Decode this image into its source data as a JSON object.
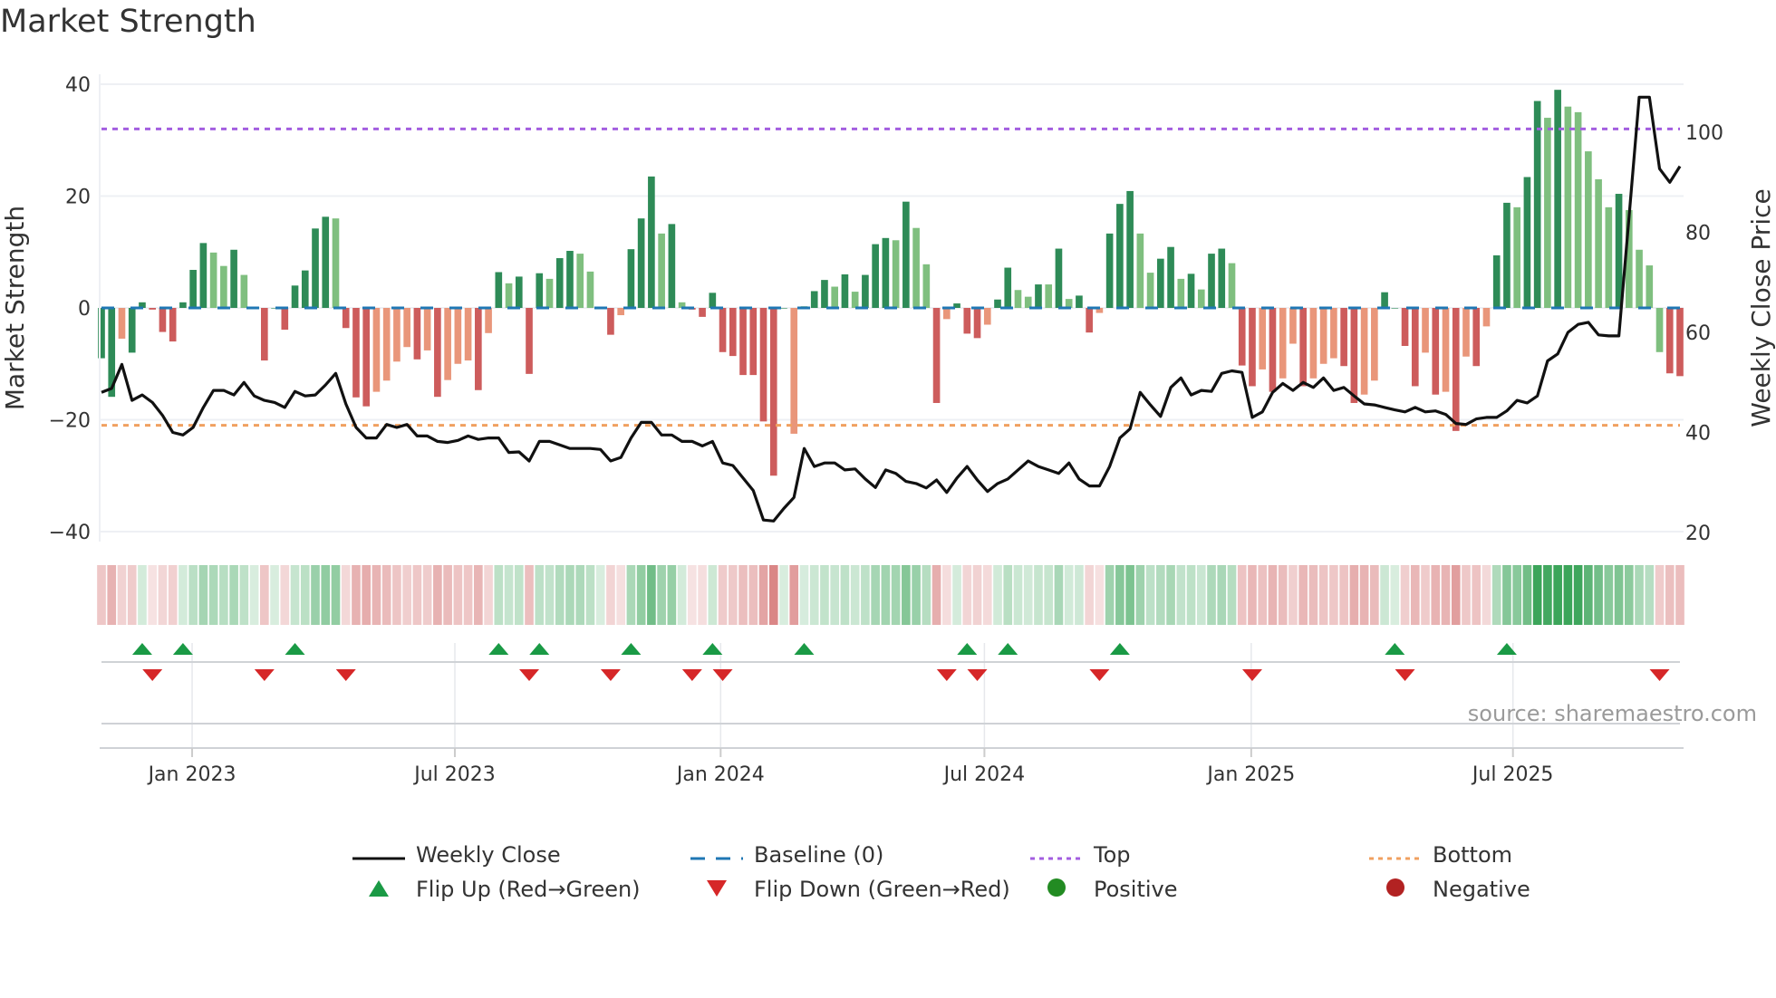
{
  "title": "Market Strength",
  "source": "source: sharemaestro.com",
  "colors": {
    "strong_up": "#2e8b57",
    "weak_up": "#7fbf7f",
    "strong_down": "#cd5c5c",
    "weak_down": "#e9967a",
    "line": "#111111",
    "baseline": "#1f77b4",
    "top": "#a35ee0",
    "bottom": "#f0a060",
    "flip_up": "#1a9a45",
    "flip_down": "#d62728",
    "positive": "#228b22",
    "negative": "#b22222"
  },
  "legend": {
    "weekly_close": "Weekly Close",
    "baseline": "Baseline (0)",
    "top": "Top",
    "bottom": "Bottom",
    "flip_up": "Flip Up (Red→Green)",
    "flip_down": "Flip Down (Green→Red)",
    "positive": "Positive",
    "negative": "Negative"
  },
  "chart_data": {
    "type": "bar",
    "title": "Market Strength",
    "ylabel": "Market Strength",
    "y2label": "Weekly Close Price",
    "ylim": [
      -42,
      42
    ],
    "y2lim": [
      20,
      110
    ],
    "yticks": [
      "40",
      "20",
      "0",
      "−20",
      "−40"
    ],
    "ytick_values": [
      40,
      20,
      0,
      -20,
      -40
    ],
    "y2ticks": [
      "100",
      "80",
      "60",
      "40",
      "20"
    ],
    "y2tick_values": [
      100,
      80,
      60,
      40,
      20
    ],
    "top_level": 32,
    "bottom_level": -21,
    "xticks": [
      {
        "label": "Jan 2023",
        "week": 8.9
      },
      {
        "label": "Jul 2023",
        "week": 34.7
      },
      {
        "label": "Jan 2024",
        "week": 60.8
      },
      {
        "label": "Jul 2024",
        "week": 86.7
      },
      {
        "label": "Jan 2025",
        "week": 112.9
      },
      {
        "label": "Jul 2025",
        "week": 138.6
      }
    ],
    "strength": [
      -9,
      -15.9,
      -5.5,
      -8,
      1,
      -0.3,
      -4.3,
      -6,
      1,
      6.8,
      11.6,
      9.9,
      7.5,
      10.4,
      5.9,
      0,
      -9.4,
      0,
      -3.9,
      4,
      6.7,
      14.2,
      16.3,
      16,
      -3.6,
      -16,
      -17.6,
      -15,
      -13,
      -9.6,
      -7,
      -9.2,
      -7.6,
      -15.9,
      -12.9,
      -10,
      -9.4,
      -14.7,
      -4.5,
      6.4,
      4.4,
      5.6,
      -11.8,
      6.2,
      5.2,
      8.9,
      10.2,
      9.7,
      6.5,
      0,
      -4.8,
      -1.3,
      10.5,
      16,
      23.5,
      13.3,
      15,
      1,
      -0.3,
      -1.6,
      2.7,
      -7.9,
      -8.6,
      -12,
      -12,
      -20.3,
      -30,
      0,
      -22.5,
      0.3,
      3,
      5,
      3.8,
      6,
      2.9,
      5.9,
      11.4,
      12.5,
      12.1,
      19,
      14.3,
      7.8,
      -17,
      -2,
      0.8,
      -4.6,
      -5.4,
      -3,
      1.5,
      7.2,
      3.2,
      2,
      4.2,
      4.2,
      10.6,
      1.6,
      2.2,
      -4.4,
      -0.9,
      13.3,
      18.6,
      20.9,
      13.3,
      6.3,
      8.8,
      10.9,
      5.2,
      6.1,
      3.3,
      9.7,
      10.6,
      8,
      -10.3,
      -14,
      -11,
      -15,
      -12.6,
      -6.4,
      -14,
      -12.6,
      -10,
      -9,
      -10.4,
      -17,
      -15.5,
      -13,
      2.8,
      0,
      -6.8,
      -14,
      -8,
      -15.5,
      -15,
      -22,
      -8.7,
      -10.4,
      -3.3,
      9.4,
      18.8,
      18,
      23.4,
      37,
      34,
      39,
      36,
      35,
      28,
      23,
      18,
      20.4,
      17.5,
      10.4,
      7.6,
      -7.9,
      -11.7,
      -12.2
    ],
    "strength_kind": "GGrGGRRRGGGggGgGRGRGGGGgRRRrrrrRrRrrrRrGgGRGgGGggGRrGGGgGgRRGRRRRRRGrgGGgGgGGGgGggRrGRRrGGggGgGgGRrGGGggGGgGgGGgRRrRrrRrrrRRrrGGRRrRrRrRrGGgGGgGgggggGggggRRR",
    "weekly_close": [
      48,
      48.8,
      53.6,
      46.4,
      47.5,
      46,
      43.4,
      40,
      39.5,
      41,
      45,
      48.4,
      48.4,
      47.5,
      50,
      47.3,
      46.4,
      46,
      45,
      48.2,
      47.3,
      47.5,
      49.5,
      51.8,
      45.7,
      41,
      38.9,
      38.9,
      41.6,
      41,
      41.6,
      39.3,
      39.3,
      38.2,
      38,
      38.4,
      39.3,
      38.6,
      38.9,
      38.9,
      36,
      36.1,
      34.3,
      38.2,
      38.2,
      37.5,
      36.8,
      36.8,
      36.8,
      36.6,
      34.3,
      35,
      38.9,
      42,
      42,
      39.5,
      39.5,
      38.2,
      38.2,
      37.3,
      38.2,
      33.9,
      33.4,
      30.9,
      28.4,
      22.5,
      22.3,
      24.8,
      27,
      36.8,
      33.2,
      33.9,
      33.9,
      32.5,
      32.7,
      30.7,
      29,
      32.5,
      31.8,
      30.2,
      29.8,
      28.9,
      30.5,
      28,
      30.9,
      33.2,
      30.5,
      28.2,
      29.8,
      30.7,
      32.5,
      34.3,
      33.2,
      32.5,
      31.8,
      33.9,
      30.7,
      29.3,
      29.3,
      33.2,
      38.9,
      40.7,
      48,
      45.5,
      43.2,
      49,
      50.9,
      47.5,
      48.4,
      48.2,
      51.8,
      52.3,
      52,
      43,
      44.1,
      48,
      49.8,
      48.4,
      50,
      49,
      50.9,
      48.4,
      49,
      47.3,
      45.7,
      45.5,
      45,
      44.5,
      44.1,
      45,
      44.1,
      44.3,
      43.6,
      41.8,
      41.6,
      42.7,
      43,
      43,
      44.3,
      46.4,
      45.9,
      47.3,
      54.3,
      55.7,
      60,
      61.6,
      62,
      59.5,
      59.3,
      59.3,
      83,
      107,
      107,
      92.7,
      90,
      93.2
    ],
    "flip_up_weeks": [
      4,
      8,
      19,
      39,
      43,
      52,
      60,
      69,
      85,
      89,
      100,
      127,
      138
    ],
    "flip_down_weeks": [
      5,
      16,
      24,
      42,
      50,
      58,
      61,
      83,
      86,
      98,
      113,
      128,
      153
    ],
    "legend_placement": "bottom"
  }
}
